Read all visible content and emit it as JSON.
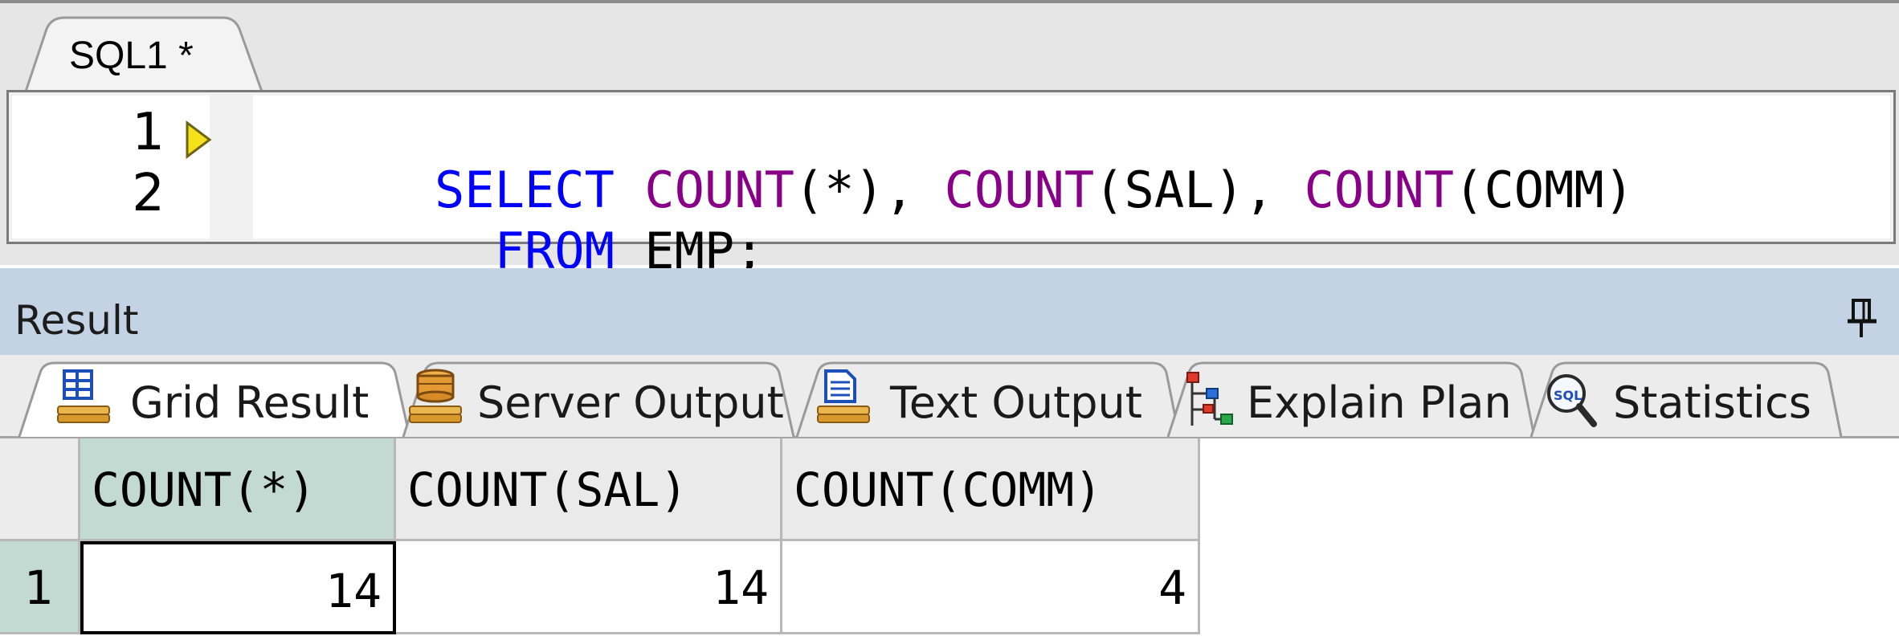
{
  "editor": {
    "tab_label": "SQL1 *",
    "lines": [
      {
        "number": "1",
        "tokens": [
          {
            "text": "SELECT ",
            "kind": "kw"
          },
          {
            "text": "COUNT",
            "kind": "fn"
          },
          {
            "text": "(*), ",
            "kind": "tx"
          },
          {
            "text": "COUNT",
            "kind": "fn"
          },
          {
            "text": "(SAL), ",
            "kind": "tx"
          },
          {
            "text": "COUNT",
            "kind": "fn"
          },
          {
            "text": "(COMM)",
            "kind": "tx"
          }
        ]
      },
      {
        "number": "2",
        "tokens": [
          {
            "text": "  FROM ",
            "kind": "kw"
          },
          {
            "text": "EMP;",
            "kind": "tx"
          }
        ]
      }
    ],
    "colors": {
      "keyword": "#0000ff",
      "function": "#880088",
      "text": "#000000"
    }
  },
  "result": {
    "title": "Result",
    "pin_icon": "pin-icon",
    "tabs": [
      {
        "label": "Grid Result",
        "icon": "grid-result-icon",
        "active": true
      },
      {
        "label": "Server Output",
        "icon": "server-output-icon",
        "active": false
      },
      {
        "label": "Text Output",
        "icon": "text-output-icon",
        "active": false
      },
      {
        "label": "Explain Plan",
        "icon": "explain-plan-icon",
        "active": false
      },
      {
        "label": "Statistics",
        "icon": "statistics-icon",
        "active": false
      }
    ]
  },
  "grid": {
    "columns": [
      "COUNT(*)",
      "COUNT(SAL)",
      "COUNT(COMM)"
    ],
    "rows": [
      {
        "row_number": "1",
        "cells": [
          "14",
          "14",
          "4"
        ]
      }
    ],
    "selected_header_color": "#c3dad2"
  }
}
